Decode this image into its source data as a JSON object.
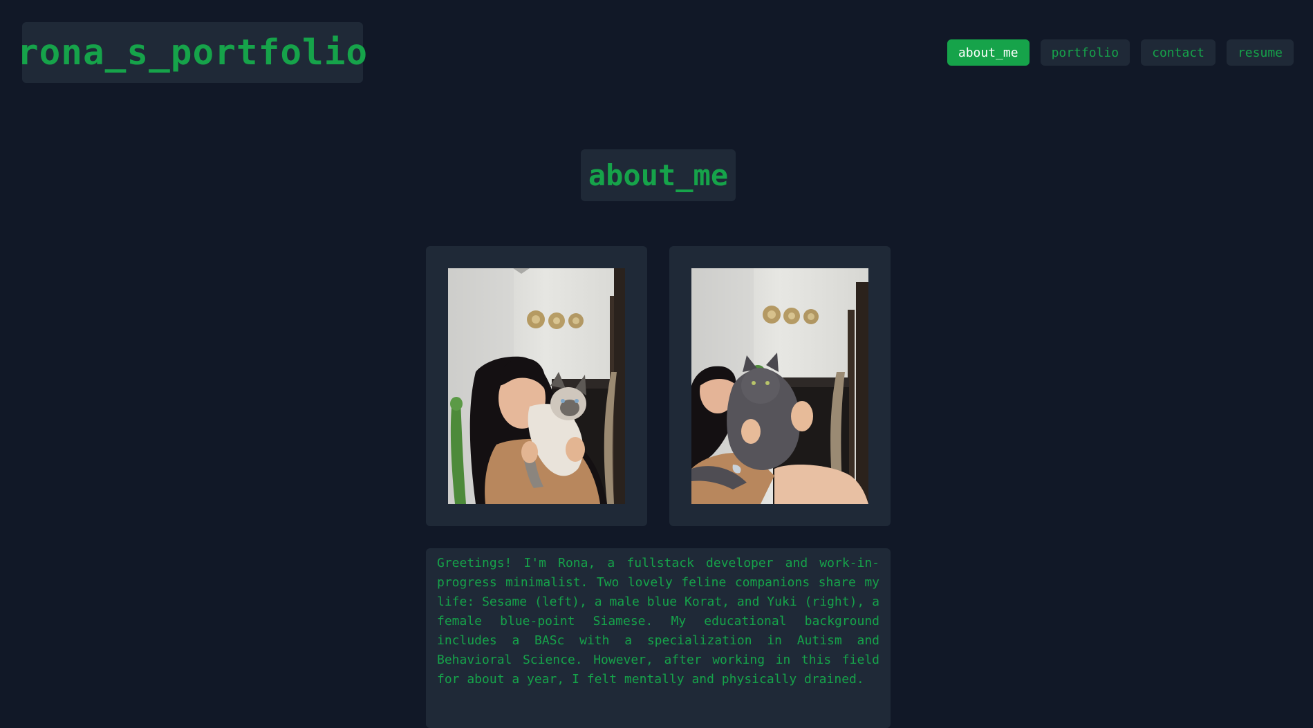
{
  "header": {
    "brand": "rona_s_portfolio"
  },
  "nav": {
    "items": [
      {
        "label": "about_me",
        "active": true
      },
      {
        "label": "portfolio",
        "active": false
      },
      {
        "label": "contact",
        "active": false
      },
      {
        "label": "resume",
        "active": false
      }
    ]
  },
  "main": {
    "section_title": "about_me",
    "photos": [
      {
        "subject": "person holding blue-point siamese cat"
      },
      {
        "subject": "person holding blue korat cat"
      }
    ],
    "bio": "Greetings! I'm Rona, a fullstack developer and work-in-progress minimalist. Two lovely feline companions share my life: Sesame (left), a male blue Korat, and Yuki (right), a female blue-point Siamese. My educational background includes a BASc with a specialization in Autism and Behavioral Science. However, after working in this field for about a year, I felt mentally and physically drained."
  },
  "colors": {
    "background": "#111827",
    "card": "#1f2937",
    "accent": "#16a34a",
    "active_text": "#ffffff"
  }
}
